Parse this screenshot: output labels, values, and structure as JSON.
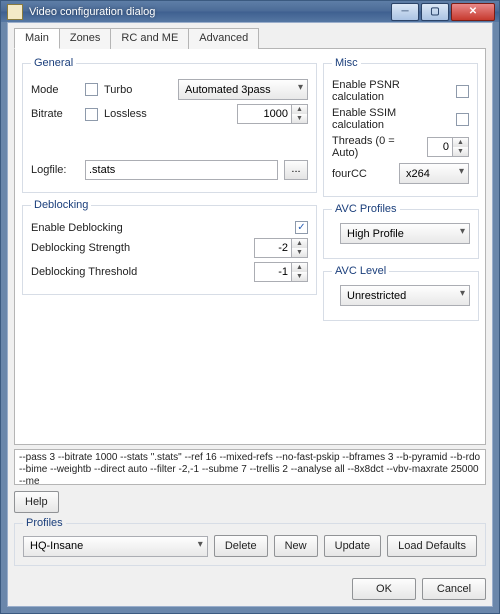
{
  "window": {
    "title": "Video configuration dialog"
  },
  "tabs": {
    "main": "Main",
    "zones": "Zones",
    "rcme": "RC and ME",
    "advanced": "Advanced"
  },
  "general": {
    "legend": "General",
    "mode_label": "Mode",
    "turbo_label": "Turbo",
    "mode_value": "Automated 3pass",
    "bitrate_label": "Bitrate",
    "lossless_label": "Lossless",
    "bitrate_value": "1000",
    "logfile_label": "Logfile:",
    "logfile_value": ".stats",
    "browse_label": "..."
  },
  "deblocking": {
    "legend": "Deblocking",
    "enable_label": "Enable Deblocking",
    "enable_checked": "✓",
    "strength_label": "Deblocking Strength",
    "strength_value": "-2",
    "threshold_label": "Deblocking Threshold",
    "threshold_value": "-1"
  },
  "misc": {
    "legend": "Misc",
    "psnr_label": "Enable PSNR calculation",
    "ssim_label": "Enable SSIM calculation",
    "threads_label": "Threads (0 = Auto)",
    "threads_value": "0",
    "fourcc_label": "fourCC",
    "fourcc_value": "x264"
  },
  "avc": {
    "profiles_legend": "AVC Profiles",
    "profile_value": "High Profile",
    "level_legend": "AVC Level",
    "level_value": "Unrestricted"
  },
  "cmdline": "--pass 3 --bitrate 1000 --stats \".stats\" --ref 16 --mixed-refs --no-fast-pskip --bframes 3 --b-pyramid --b-rdo --bime --weightb --direct auto --filter -2,-1 --subme 7 --trellis 2 --analyse all  --8x8dct --vbv-maxrate 25000 --me",
  "buttons": {
    "help": "Help",
    "delete": "Delete",
    "new": "New",
    "update": "Update",
    "load_defaults": "Load Defaults",
    "ok": "OK",
    "cancel": "Cancel"
  },
  "profiles": {
    "legend": "Profiles",
    "value": "HQ-Insane"
  }
}
